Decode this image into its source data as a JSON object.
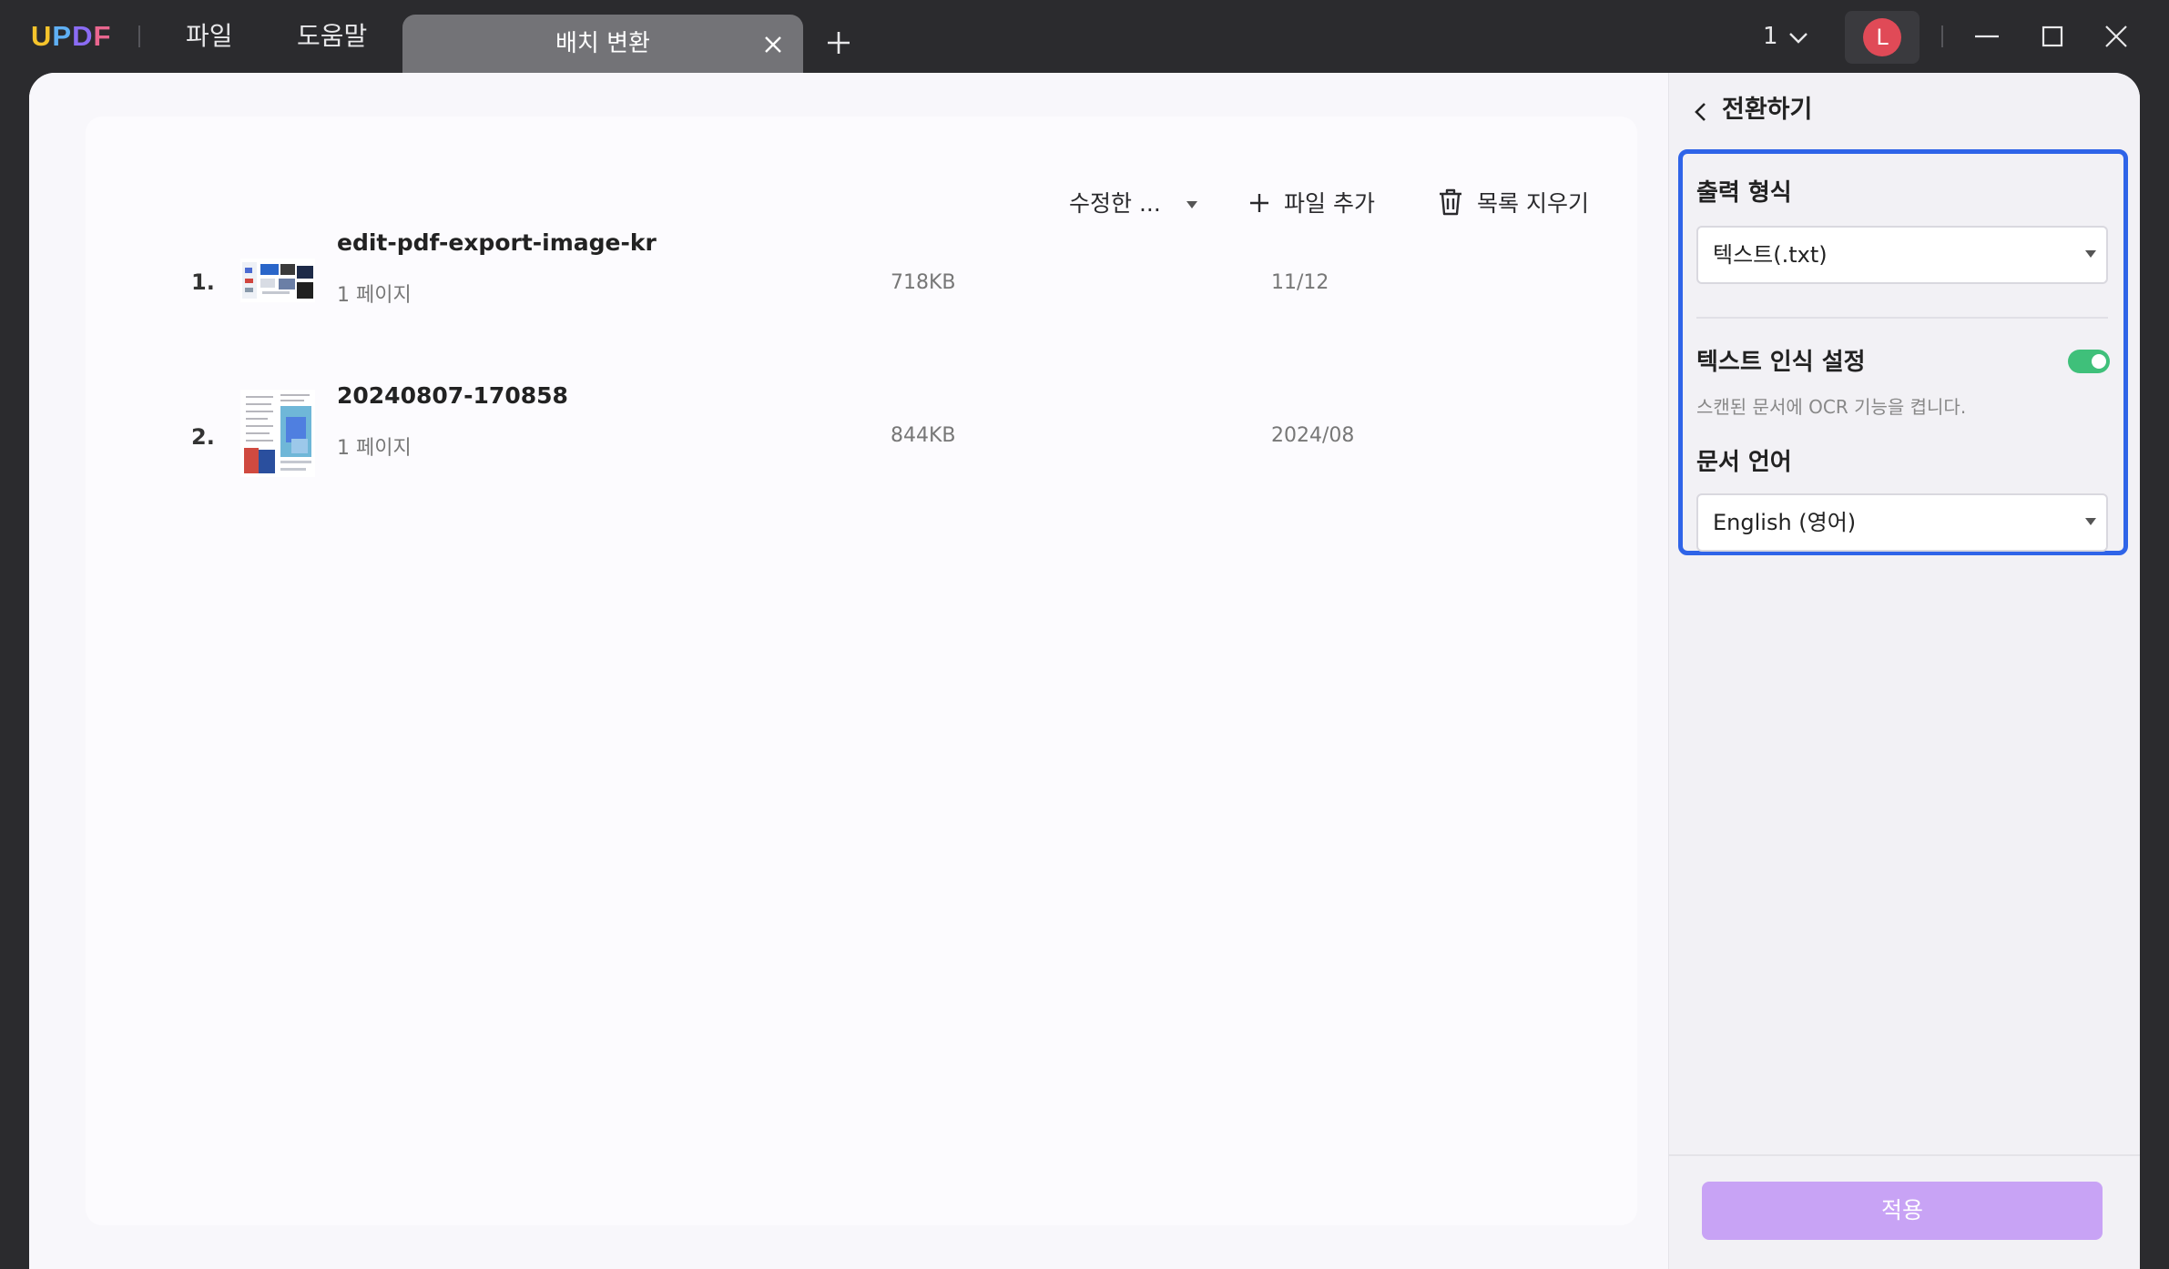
{
  "titlebar": {
    "logo": [
      "U",
      "P",
      "D",
      "F"
    ],
    "logo_colors": [
      "#f5c42c",
      "#5fb0f5",
      "#8b6cf5",
      "#e9668f"
    ],
    "menu": {
      "file": "파일",
      "help": "도움말"
    },
    "tab_label": "배치 변환",
    "page_count": "1",
    "avatar_letter": "L"
  },
  "toolbar": {
    "sort_label": "수정한 ...",
    "add_file": "파일 추가",
    "clear_list": "목록 지우기"
  },
  "files": [
    {
      "index": "1.",
      "name": "edit-pdf-export-image-kr",
      "pages": "1 페이지",
      "size": "718KB",
      "date": "11/12"
    },
    {
      "index": "2.",
      "name": "20240807-170858",
      "pages": "1 페이지",
      "size": "844KB",
      "date": "2024/08"
    }
  ],
  "panel": {
    "title": "전환하기",
    "output_format_label": "출력 형식",
    "output_format_value": "텍스트(.txt)",
    "ocr_label": "텍스트 인식 설정",
    "ocr_enabled": true,
    "ocr_desc": "스캔된 문서에 OCR 기능을 켭니다.",
    "doc_lang_label": "문서 언어",
    "doc_lang_value": "English (영어)",
    "apply": "적용"
  },
  "colors": {
    "highlight": "#2f64e8",
    "toggle_on": "#3fc07a",
    "apply_button": "#c8a3f5",
    "avatar": "#e04a57"
  }
}
